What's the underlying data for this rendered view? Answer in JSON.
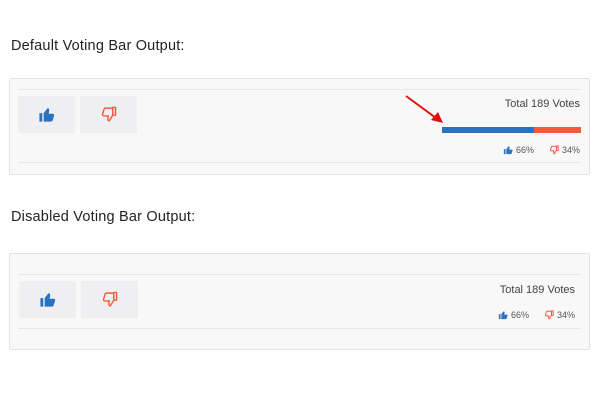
{
  "sections": [
    {
      "title": "Default Voting Bar Output:",
      "total_label": "Total 189 Votes",
      "up_percent_label": "66%",
      "down_percent_label": "34%",
      "up_fraction": 0.66,
      "down_fraction": 0.34
    },
    {
      "title": "Disabled Voting Bar Output:",
      "total_label": "Total 189 Votes",
      "up_percent_label": "66%",
      "down_percent_label": "34%"
    }
  ],
  "colors": {
    "up": "#2a72c0",
    "down": "#f15a3a",
    "annotation_arrow": "#e01010"
  },
  "icons": {
    "up": "thumbs-up-icon",
    "down": "thumbs-down-icon"
  }
}
